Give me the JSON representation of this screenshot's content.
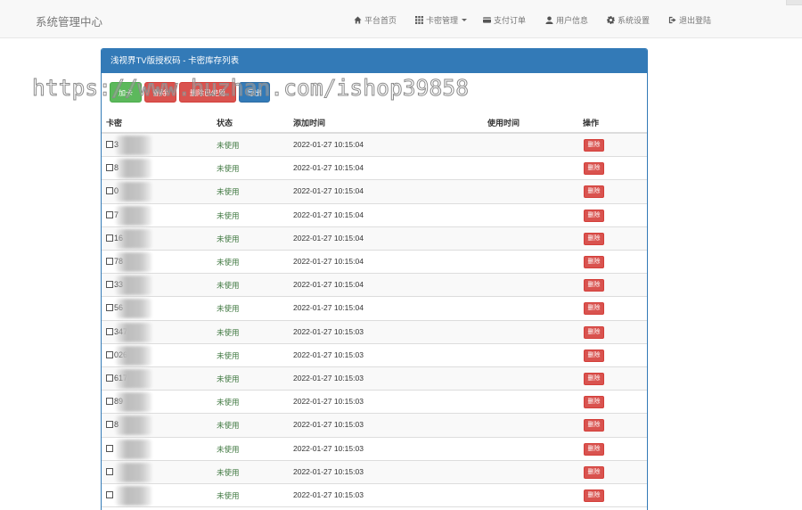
{
  "navbar": {
    "brand": "系统管理中心",
    "items": [
      {
        "label": "平台首页",
        "icon": "home-icon"
      },
      {
        "label": "卡密管理",
        "icon": "grid-icon"
      },
      {
        "label": "支付订单",
        "icon": "credit-card-icon"
      },
      {
        "label": "用户信息",
        "icon": "user-icon"
      },
      {
        "label": "系统设置",
        "icon": "gear-icon"
      },
      {
        "label": "退出登陆",
        "icon": "logout-icon"
      }
    ]
  },
  "panel": {
    "title": "浅视界TV版授权码 - 卡密库存列表",
    "buttons": [
      "加卡",
      "删除",
      "删除已使用",
      "导出"
    ]
  },
  "watermark": "https://www.huzhan.com/ishop39858",
  "table": {
    "headers": [
      "卡密",
      "状态",
      "添加时间",
      "使用时间",
      "操作"
    ],
    "rows": [
      {
        "code": "3",
        "status": "未使用",
        "added": "2022-01-27 10:15:04",
        "used": "",
        "action": "删除"
      },
      {
        "code": "8",
        "status": "未使用",
        "added": "2022-01-27 10:15:04",
        "used": "",
        "action": "删除"
      },
      {
        "code": "0",
        "status": "未使用",
        "added": "2022-01-27 10:15:04",
        "used": "",
        "action": "删除"
      },
      {
        "code": "7",
        "status": "未使用",
        "added": "2022-01-27 10:15:04",
        "used": "",
        "action": "删除"
      },
      {
        "code": "16",
        "status": "未使用",
        "added": "2022-01-27 10:15:04",
        "used": "",
        "action": "删除"
      },
      {
        "code": "78",
        "status": "未使用",
        "added": "2022-01-27 10:15:04",
        "used": "",
        "action": "删除"
      },
      {
        "code": "33",
        "status": "未使用",
        "added": "2022-01-27 10:15:04",
        "used": "",
        "action": "删除"
      },
      {
        "code": "56",
        "status": "未使用",
        "added": "2022-01-27 10:15:04",
        "used": "",
        "action": "删除"
      },
      {
        "code": "347",
        "status": "未使用",
        "added": "2022-01-27 10:15:03",
        "used": "",
        "action": "删除"
      },
      {
        "code": "026",
        "status": "未使用",
        "added": "2022-01-27 10:15:03",
        "used": "",
        "action": "删除"
      },
      {
        "code": "617",
        "status": "未使用",
        "added": "2022-01-27 10:15:03",
        "used": "",
        "action": "删除"
      },
      {
        "code": "89",
        "status": "未使用",
        "added": "2022-01-27 10:15:03",
        "used": "",
        "action": "删除"
      },
      {
        "code": "8",
        "status": "未使用",
        "added": "2022-01-27 10:15:03",
        "used": "",
        "action": "删除"
      },
      {
        "code": "",
        "status": "未使用",
        "added": "2022-01-27 10:15:03",
        "used": "",
        "action": "删除"
      },
      {
        "code": "",
        "status": "未使用",
        "added": "2022-01-27 10:15:03",
        "used": "",
        "action": "删除"
      },
      {
        "code": "",
        "status": "未使用",
        "added": "2022-01-27 10:15:03",
        "used": "",
        "action": "删除"
      }
    ]
  }
}
